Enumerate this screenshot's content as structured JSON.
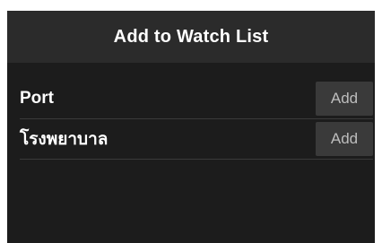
{
  "header": {
    "title": "Add to Watch List"
  },
  "items": [
    {
      "label": "Port",
      "button": "Add"
    },
    {
      "label": "โรงพยาบาล",
      "button": "Add"
    }
  ],
  "colors": {
    "header_bg": "#2b2b2b",
    "panel_bg": "#1c1c1c",
    "button_bg": "#3a3a3a",
    "text": "#ffffff",
    "button_text": "#bdbdbd"
  }
}
